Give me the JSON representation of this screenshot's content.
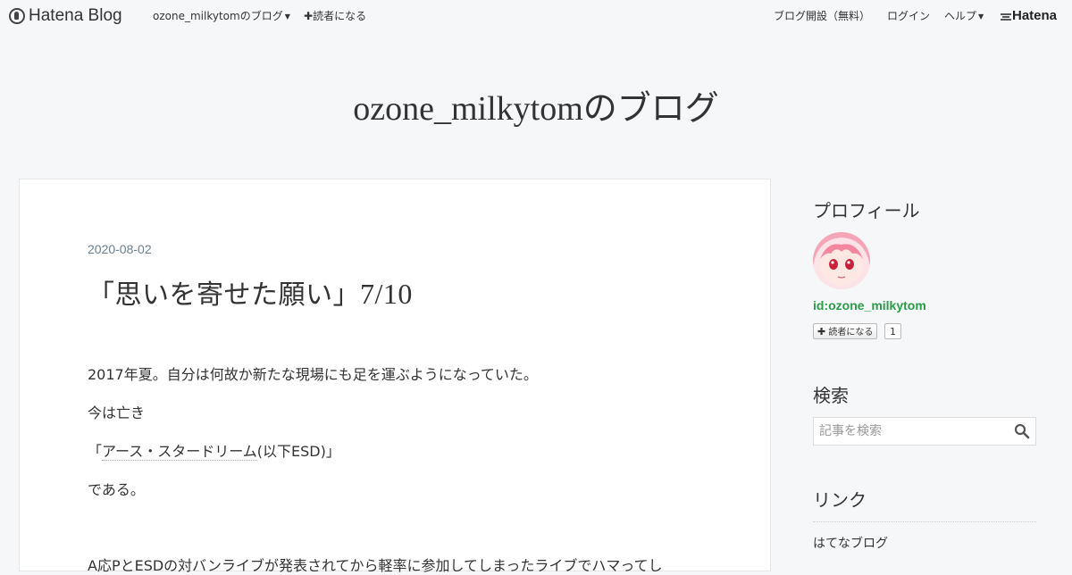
{
  "topbar": {
    "logo_text": "Hatena Blog",
    "blog_menu": "ozone_milkytomのブログ",
    "subscribe": "読者になる",
    "open_blog": "ブログ開設（無料）",
    "login": "ログイン",
    "help": "ヘルプ",
    "hatena": "Hatena"
  },
  "blog_title": "ozone_milkytomのブログ",
  "entry": {
    "date": "2020-08-02",
    "title_open": "「思いを寄せた願い」",
    "title_num": "7/10",
    "p1": "2017年夏。自分は何故か新たな現場にも足を運ぶようになっていた。",
    "p2": "今は亡き",
    "p3_open": "「",
    "p3_keyword": "アース・スタードリーム",
    "p3_rest": "(以下ESD)」",
    "p4": "である。",
    "p5": "A応PとESDの対バンライブが発表されてから軽率に参加してしまったライブでハマってし"
  },
  "sidebar": {
    "profile_heading": "プロフィール",
    "profile_id": "id:ozone_milkytom",
    "subscribe_button": "読者になる",
    "subscriber_count": "1",
    "search_heading": "検索",
    "search_placeholder": "記事を検索",
    "links_heading": "リンク",
    "links": [
      "はてなブログ"
    ]
  }
}
